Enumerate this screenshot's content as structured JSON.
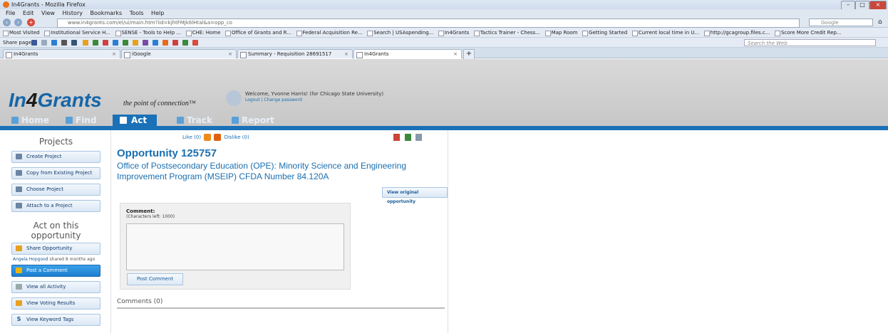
{
  "browser": {
    "window_title": "In4Grants - Mozilla Firefox",
    "menu": [
      "File",
      "Edit",
      "View",
      "History",
      "Bookmarks",
      "Tools",
      "Help"
    ],
    "url": "www.in4grants.com/el/ui/main.htm?iid=kjhtFMJk6lHtal&a=opp_co",
    "search_engine": "Google",
    "bookmarks": [
      "Most Visited",
      "Institutional Service H...",
      "SENSE - Tools to Help ...",
      "CHE: Home",
      "Office of Grants and R...",
      "Federal Acquisition Re...",
      "Search | USAspending...",
      "In4Grants",
      "Tactics Trainer - Chess...",
      "Map Room",
      "Getting Started",
      "Current local time in U...",
      "http://gcagroup.files.c...",
      "Score More Credit Rep..."
    ],
    "share_label": "Share page:",
    "web_search_placeholder": "Search the Web",
    "tabs": [
      {
        "label": "In4Grants",
        "active": false
      },
      {
        "label": "iGoogle",
        "active": false
      },
      {
        "label": "Summary - Requisition 28691517",
        "active": false
      },
      {
        "label": "In4Grants",
        "active": true
      }
    ]
  },
  "site": {
    "logo_prefix": "In",
    "logo_four": "4",
    "logo_suffix": "Grants",
    "tagline": "the point of connection™",
    "welcome": "Welcome, Yvonne Harris! (for Chicago State University)",
    "logout": "Logout",
    "change_password": "Change password",
    "nav": [
      {
        "label": "Home",
        "active": false
      },
      {
        "label": "Find",
        "active": false
      },
      {
        "label": "Act",
        "active": true
      },
      {
        "label": "Track",
        "active": false
      },
      {
        "label": "Report",
        "active": false
      }
    ]
  },
  "sidebar": {
    "projects_heading": "Projects",
    "project_buttons": [
      "Create Project",
      "Copy from Existing Project",
      "Choose Project",
      "Attach to a Project"
    ],
    "act_heading_1": "Act on this",
    "act_heading_2": "opportunity",
    "share_button": "Share Opportunity",
    "share_user": "Angela Hopgood",
    "share_note": "shared 8 months ago",
    "post_button": "Post a Comment",
    "activity_button": "View all Activity",
    "voting_button": "View Voting Results",
    "keyword_button": "View Keyword Tags"
  },
  "content": {
    "like_label": "Like (0)",
    "dislike_label": "Dislike (0)",
    "title": "Opportunity 125757",
    "description": "Office of Postsecondary Education (OPE): Minority Science and Engineering Improvement Program (MSEIP) CFDA Number 84.120A",
    "view_original": "View original opportunity",
    "comment_label": "Comment:",
    "chars_left": "(Characters left: 1000)",
    "post_comment": "Post Comment",
    "comments_header": "Comments (0)"
  },
  "colors": {
    "brand_blue": "#1a71b8",
    "link_blue": "#1a6fb0",
    "active_button": "#2a8fdc"
  }
}
